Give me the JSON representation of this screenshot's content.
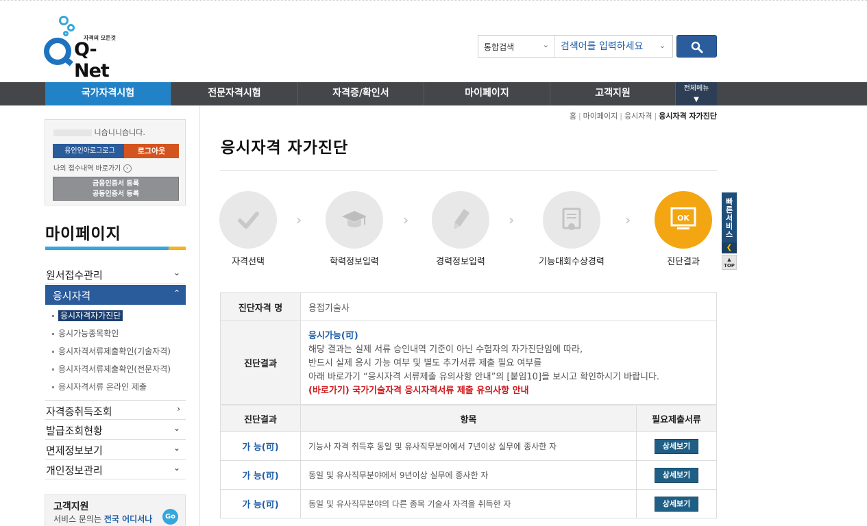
{
  "header": {
    "logo_tagline": "자격의 모든것",
    "logo_text": "Q-Net",
    "search_scope": "통합검색",
    "search_placeholder": "검색어를 입력하세요"
  },
  "gnb": {
    "items": [
      "국가자격시험",
      "전문자격시험",
      "자격증/확인서",
      "마이페이지",
      "고객지원"
    ],
    "all_menu": "전체메뉴",
    "active_index": 0
  },
  "login": {
    "greeting": "니습니니습니다.",
    "change_pw_label": "용인인아로그로그",
    "logout_label": "로그아웃",
    "receipt_link": "나의 접수내역 바로가기",
    "cert_register_1": "금융인증서 등록",
    "cert_register_2": "공동인증서 등록"
  },
  "lnb": {
    "title": "마이페이지",
    "items": [
      {
        "label": "원서접수관리",
        "icon": "chevron-down"
      },
      {
        "label": "응시자격",
        "icon": "chevron-up",
        "open": true
      },
      {
        "label": "자격증취득조회",
        "icon": "chevron-right"
      },
      {
        "label": "발급조회현황",
        "icon": "chevron-down"
      },
      {
        "label": "면제정보보기",
        "icon": "chevron-down"
      },
      {
        "label": "개인정보관리",
        "icon": "chevron-down"
      }
    ],
    "sub_items": [
      "응시자격자가진단",
      "응시가능종목확인",
      "응시자격서류제출확인(기술자격)",
      "응시자격서류제출확인(전문자격)",
      "응시자격서류 온라인 제출"
    ],
    "current_sub": 0
  },
  "customer_service": {
    "title": "고객지원",
    "text_prefix": "서비스 문의는 ",
    "text_highlight": "전국 어디서나",
    "go_label": "Go"
  },
  "breadcrumb": [
    "홈",
    "마이페이지",
    "응시자격",
    "응시자격 자가진단"
  ],
  "page_title": "응시자격 자가진단",
  "steps": [
    {
      "label": "자격선택",
      "icon": "check-icon"
    },
    {
      "label": "학력정보입력",
      "icon": "graduation-cap-icon"
    },
    {
      "label": "경력정보입력",
      "icon": "pencil-icon"
    },
    {
      "label": "기능대회수상경력",
      "icon": "certificate-icon"
    },
    {
      "label": "진단결과",
      "icon": "ok-monitor-icon",
      "active": true
    }
  ],
  "quick": {
    "label": "빠른서비스",
    "top": "TOP"
  },
  "result": {
    "name_header": "진단자격 명",
    "name_value": "용접기술사",
    "result_header": "진단결과",
    "status": "응시가능(可)",
    "line1": "해당 결과는 실제 서류 승인내역 기준이 아닌 수험자의 자가진단임에 따라,",
    "line2": "반드시 실제 응시 가능 여부 및 별도 추가서류 제출 필요 여부를",
    "line3": "아래 바로가기 “응시자격 서류제출 유의사항 안내”의 [붙임10]을 보시고 확인하시기 바랍니다.",
    "link": "(바로가기) 국가기술자격 응시자격서류 제출 유의사항 안내"
  },
  "items_table": {
    "headers": [
      "진단결과",
      "항목",
      "필요제출서류"
    ],
    "rows": [
      {
        "result": "가 능(可)",
        "desc": "기능사 자격 취득후 동일 및 유사직무분야에서 7년이상 실무에 종사한 자",
        "button": "상세보기"
      },
      {
        "result": "가 능(可)",
        "desc": "동일 및 유사직무분야에서 9년이상 실무에 종사한 자",
        "button": "상세보기"
      },
      {
        "result": "가 능(可)",
        "desc": "동일 및 유사직무분야의 다른 종목 기술사 자격을 취득한 자",
        "button": "상세보기"
      }
    ]
  },
  "colors": {
    "brand_blue": "#2282c8",
    "nav_bg": "#444649",
    "ok_orange": "#f3a612",
    "alert_red": "#d0181b"
  }
}
